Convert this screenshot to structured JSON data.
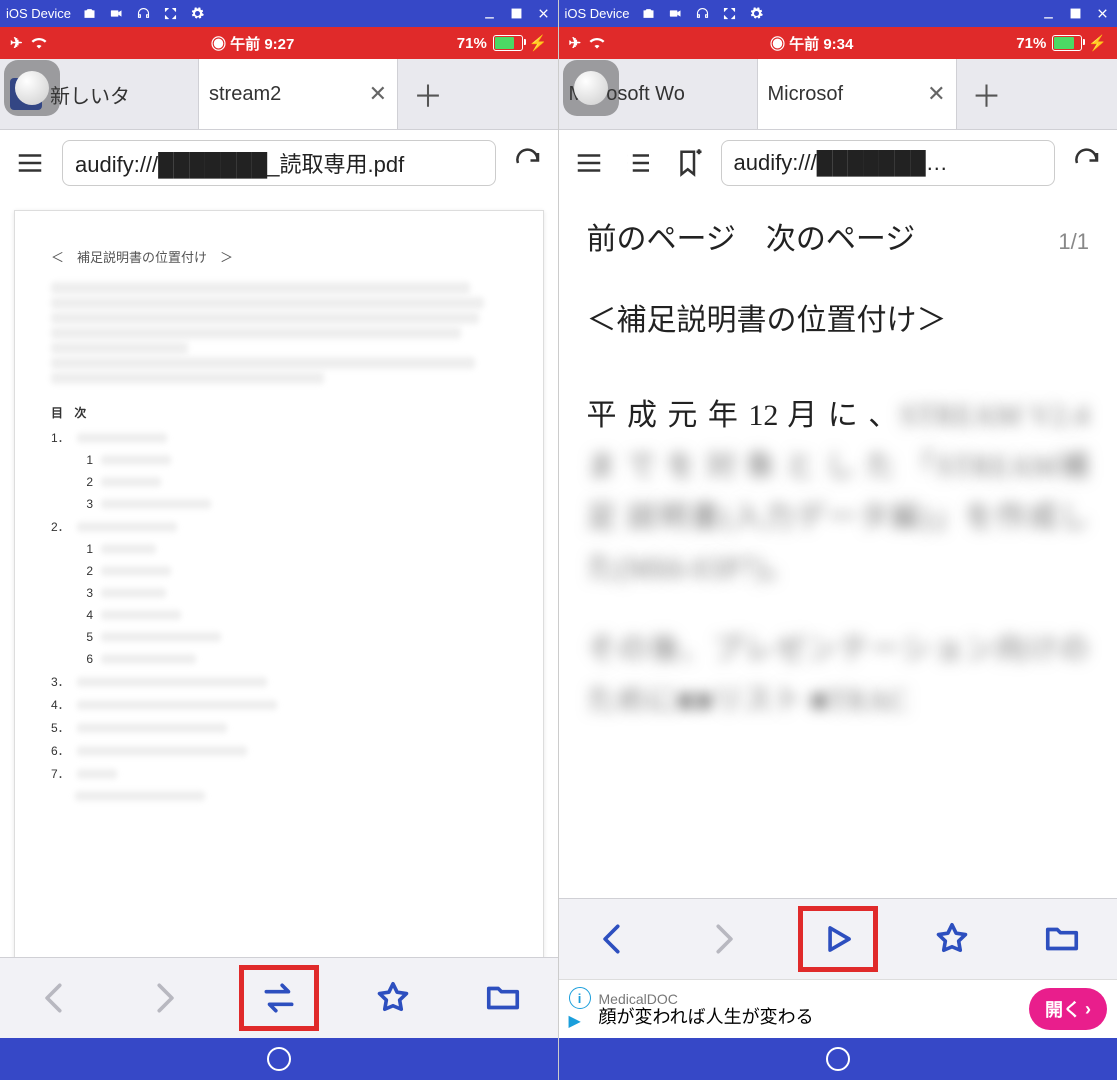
{
  "emu": {
    "title": "iOS Device"
  },
  "left": {
    "status": {
      "time": "午前 9:27",
      "rec_prefix": "◉",
      "battery": "71%"
    },
    "tabs": {
      "t0": "新しいタ",
      "t1": "stream2"
    },
    "url": "audify:///███████_読取専用.pdf",
    "pdf": {
      "heading": "＜　補足説明書の位置付け　＞",
      "toc_label": "目 次",
      "items": {
        "n1": "1．",
        "n1_1": "1",
        "n1_2": "2",
        "n1_3": "3",
        "n2": "2．",
        "n2_1": "1",
        "n2_2": "2",
        "n2_3": "3",
        "n2_4": "4",
        "n2_5": "5",
        "n2_6": "6",
        "n3": "3．",
        "n4": "4．",
        "n5": "5．",
        "n6": "6．",
        "n7": "7．"
      }
    }
  },
  "right": {
    "status": {
      "time": "午前 9:34",
      "rec_prefix": "◉",
      "battery": "71%"
    },
    "tabs": {
      "t0": "Microsoft Wo",
      "t1": "Microsof"
    },
    "url": "audify:///███████…",
    "nav": {
      "prev": "前のページ",
      "next": "次のページ",
      "counter": "1/1"
    },
    "body": {
      "h": "＜補足説明書の位置付け＞",
      "p1a": "平 成 元 年 12 月 に 、",
      "p1b_blur": "STREAM V2.4 ま で を 対 象 と し た 「STREAM補足 説明書(入力データ編)」を作成した(M66-03P7)。",
      "p2_blur": "その後、プレゼンテーション向けのために■■リスト ■TRAC"
    },
    "ad": {
      "publisher": "MedicalDOC",
      "headline": "顔が変われば人生が変わる",
      "cta": "開く"
    }
  }
}
